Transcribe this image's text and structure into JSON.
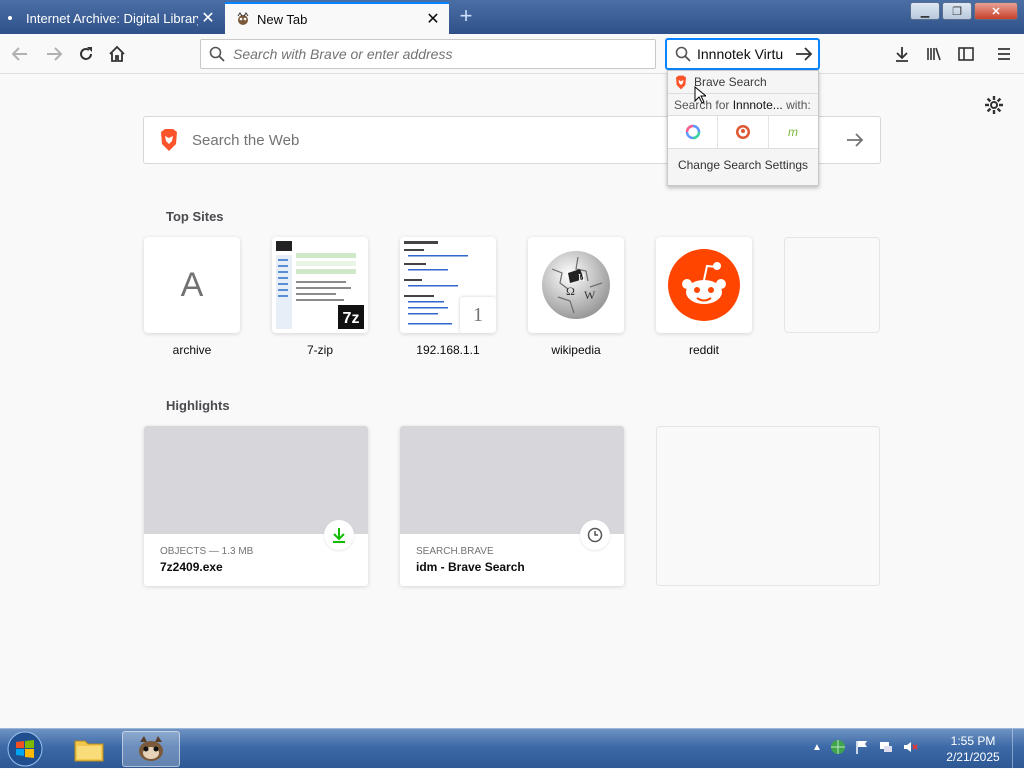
{
  "tabs": [
    {
      "title": "Internet Archive: Digital Library",
      "active": false
    },
    {
      "title": "New Tab",
      "active": true
    }
  ],
  "urlbar": {
    "placeholder": "Search with Brave or enter address"
  },
  "searchbar": {
    "value": "Innnotek Virtu"
  },
  "search_dropdown": {
    "engine_label": "Brave Search",
    "search_for_prefix": "Search for",
    "search_for_query": "Innnote...",
    "search_for_suffix": "with:",
    "engines": [
      "qwant-icon",
      "duckduckgo-icon",
      "mojeek-icon"
    ],
    "change_settings": "Change Search Settings"
  },
  "websearch": {
    "placeholder": "Search the Web"
  },
  "top_sites": {
    "title": "Top Sites",
    "items": [
      {
        "label": "archive",
        "letter": "A"
      },
      {
        "label": "7-zip"
      },
      {
        "label": "192.168.1.1",
        "badge": "1"
      },
      {
        "label": "wikipedia"
      },
      {
        "label": "reddit"
      },
      {
        "label": ""
      }
    ]
  },
  "highlights": {
    "title": "Highlights",
    "items": [
      {
        "source": "OBJECTS — 1.3 MB",
        "name": "7z2409.exe",
        "badge": "download-icon"
      },
      {
        "source": "SEARCH.BRAVE",
        "name": "idm - Brave Search",
        "badge": "clock-icon"
      }
    ]
  },
  "taskbar": {
    "time": "1:55 PM",
    "date": "2/21/2025"
  },
  "colors": {
    "accent": "#0a84ff",
    "brave": "#fb542b",
    "reddit": "#ff4500"
  }
}
